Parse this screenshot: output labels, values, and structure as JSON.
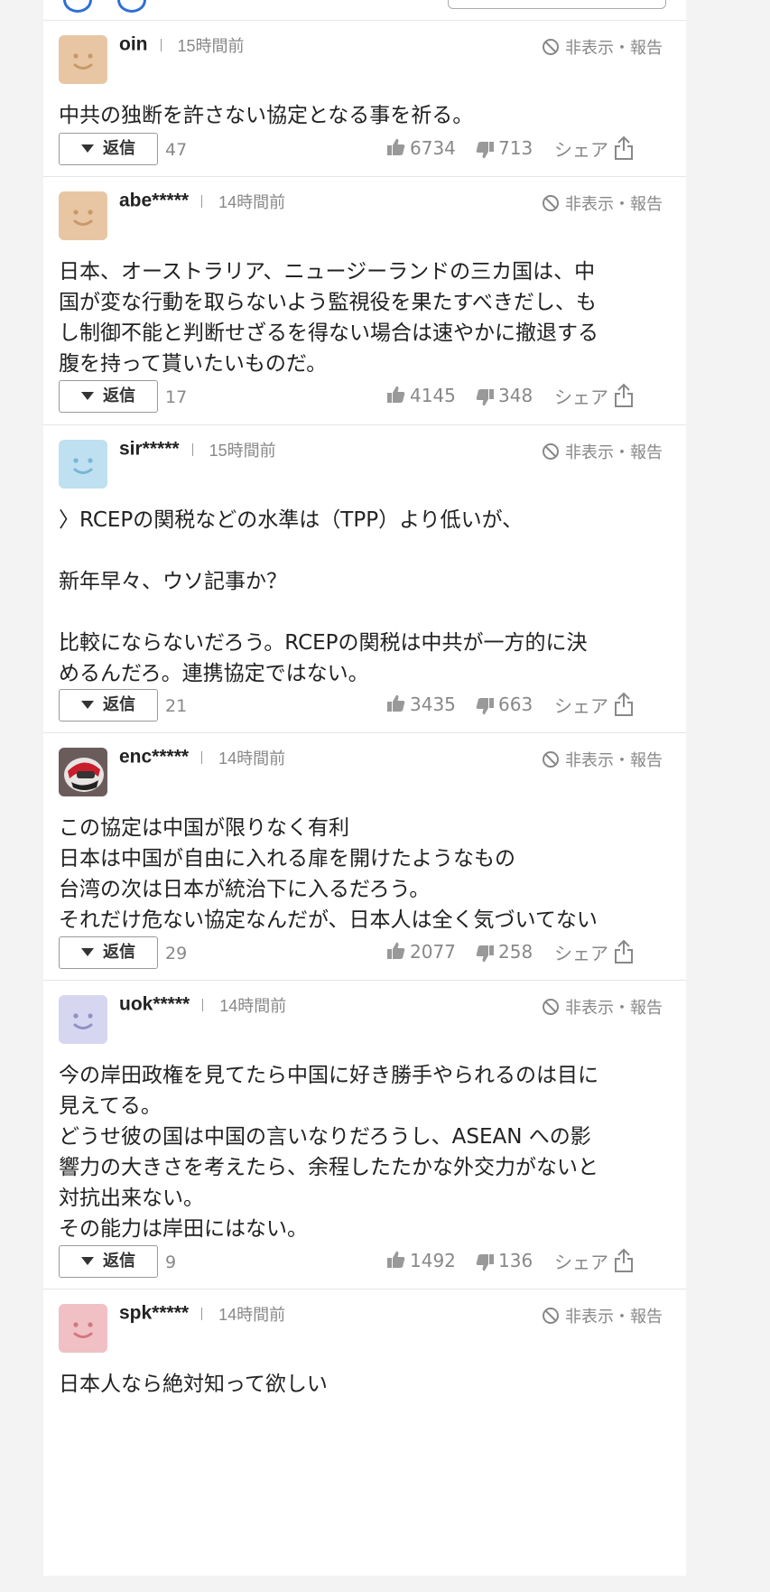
{
  "labels": {
    "hide_report": "非表示・報告",
    "reply": "返信",
    "share": "シェア"
  },
  "comments": [
    {
      "user": "oin",
      "time": "15時間前",
      "avatar_color": "#e8c6a4",
      "face_color": "#c99869",
      "text": "中共の独断を許さない協定となる事を祈る。",
      "replies": "47",
      "likes": "6734",
      "dislikes": "713"
    },
    {
      "user": "abe*****",
      "time": "14時間前",
      "avatar_color": "#e8c6a4",
      "face_color": "#c99869",
      "text": "日本、オーストラリア、ニュージーランドの三カ国は、中\n国が変な行動を取らないよう監視役を果たすべきだし、も\nし制御不能と判断せざるを得ない場合は速やかに撤退する\n腹を持って貰いたいものだ。",
      "replies": "17",
      "likes": "4145",
      "dislikes": "348"
    },
    {
      "user": "sir*****",
      "time": "15時間前",
      "avatar_color": "#bfe0f0",
      "face_color": "#77b6d6",
      "text": "〉RCEPの関税などの水準は（TPP）より低いが、\n\n新年早々、ウソ記事か？\n\n比較にならないだろう。RCEPの関税は中共が一方的に決\nめるんだろ。連携協定ではない。",
      "replies": "21",
      "likes": "3435",
      "dislikes": "663"
    },
    {
      "user": "enc*****",
      "time": "14時間前",
      "avatar_color": "#7a6a6a",
      "face_color": "#c0303a",
      "text": "この協定は中国が限りなく有利\n日本は中国が自由に入れる扉を開けたようなもの\n台湾の次は日本が統治下に入るだろう。\nそれだけ危ない協定なんだが、日本人は全く気づいてない",
      "replies": "29",
      "likes": "2077",
      "dislikes": "258"
    },
    {
      "user": "uok*****",
      "time": "14時間前",
      "avatar_color": "#d6d6f0",
      "face_color": "#9090c8",
      "text": "今の岸田政権を見てたら中国に好き勝手やられるのは目に\n見えてる。\nどうせ彼の国は中国の言いなりだろうし、ASEAN への影\n響力の大きさを考えたら、余程したたかな外交力がないと\n対抗出来ない。\nその能力は岸田にはない。",
      "replies": "9",
      "likes": "1492",
      "dislikes": "136"
    },
    {
      "user": "spk*****",
      "time": "14時間前",
      "avatar_color": "#f0c0c4",
      "face_color": "#d07880",
      "text": "日本人なら絶対知って欲しい",
      "replies": "",
      "likes": "",
      "dislikes": ""
    }
  ]
}
